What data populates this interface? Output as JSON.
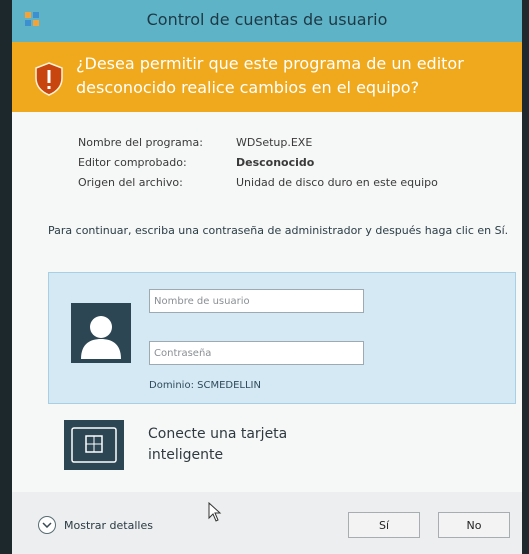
{
  "window": {
    "title": "Control de cuentas de usuario",
    "banner": "¿Desea permitir que este programa de un editor desconocido realice cambios en el equipo?"
  },
  "info": [
    {
      "label": "Nombre del programa:",
      "value": "WDSetup.EXE"
    },
    {
      "label": "Editor comprobado:",
      "value": "Desconocido"
    },
    {
      "label": "Origen del archivo:",
      "value": "Unidad de disco duro en este equipo"
    }
  ],
  "instruction": "Para continuar, escriba una contraseña de administrador y después haga clic en Sí.",
  "credentials": {
    "username_placeholder": "Nombre de usuario",
    "password_placeholder": "Contraseña",
    "domain": "Dominio: SCMEDELLIN"
  },
  "smartcard": {
    "label": "Conecte una tarjeta inteligente"
  },
  "footer": {
    "details_label": "Mostrar detalles",
    "yes_label": "Sí",
    "no_label": "No"
  },
  "icons": {
    "app": "app-icon",
    "shield": "shield-warning-icon",
    "user": "user-icon",
    "smartcard": "smartcard-icon",
    "chevron": "chevron-down-icon",
    "cursor": "mouse-cursor-icon"
  },
  "colors": {
    "titlebar": "#5fb3c7",
    "banner": "#f0a91c",
    "tile": "#d5e9f5",
    "icon_bg": "#2d4653"
  }
}
